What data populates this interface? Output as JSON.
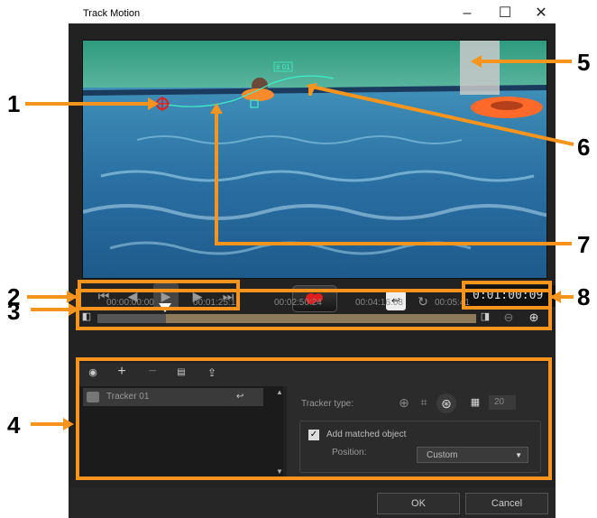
{
  "window": {
    "title": "Track Motion"
  },
  "timecode": "0:01:00:09",
  "timeline": {
    "ticks": [
      "00:00:00:00",
      "00:01:25:12",
      "00:02:50:24",
      "00:04:16:08",
      "00:05:41"
    ]
  },
  "video": {
    "tracker_label": "# 01"
  },
  "tracker_list": {
    "items": [
      "Tracker 01"
    ]
  },
  "properties": {
    "tracker_type_label": "Tracker type:",
    "size_value": "20",
    "add_matched_label": "Add matched object",
    "add_matched_checked": true,
    "position_label": "Position:",
    "position_value": "Custom"
  },
  "buttons": {
    "ok": "OK",
    "cancel": "Cancel"
  },
  "annotations": [
    "1",
    "2",
    "3",
    "4",
    "5",
    "6",
    "7",
    "8"
  ],
  "colors": {
    "annotation": "#f7941d",
    "tracker_circle": "#e02020",
    "tracker_path": "#3ff0c8"
  }
}
